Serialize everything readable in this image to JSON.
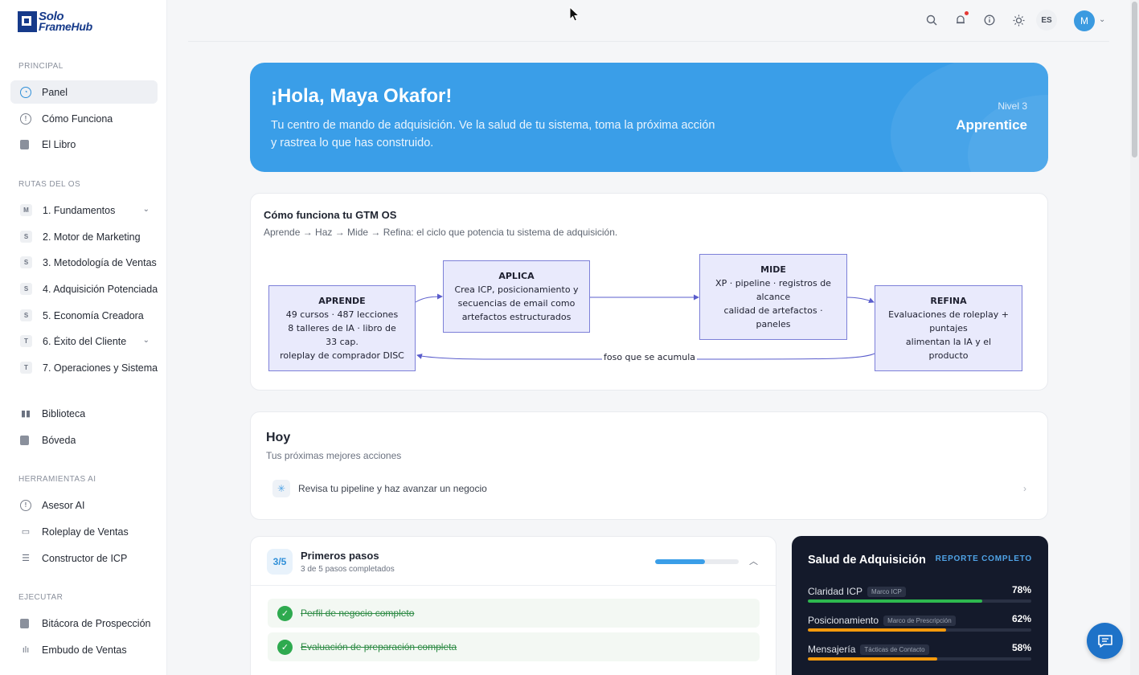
{
  "brand": {
    "line1": "Solo",
    "line2": "FrameHub"
  },
  "sidebar": {
    "principal_label": "PRINCIPAL",
    "principal": [
      {
        "label": "Panel",
        "icon": "dashboard-icon",
        "active": true
      },
      {
        "label": "Cómo Funciona",
        "icon": "info-icon"
      },
      {
        "label": "El Libro",
        "icon": "book-icon"
      }
    ],
    "routes_label": "RUTAS DEL OS",
    "routes": [
      {
        "badge": "M",
        "label": "1. Fundamentos"
      },
      {
        "badge": "S",
        "label": "2. Motor de Marketing"
      },
      {
        "badge": "S",
        "label": "3. Metodología de Ventas"
      },
      {
        "badge": "S",
        "label": "4. Adquisición Potenciada"
      },
      {
        "badge": "S",
        "label": "5. Economía Creadora"
      },
      {
        "badge": "T",
        "label": "6. Éxito del Cliente"
      },
      {
        "badge": "T",
        "label": "7. Operaciones y Sistemas"
      }
    ],
    "library": [
      {
        "label": "Biblioteca",
        "icon": "library-icon"
      },
      {
        "label": "Bóveda",
        "icon": "vault-icon"
      }
    ],
    "ai_label": "HERRAMIENTAS AI",
    "ai": [
      {
        "label": "Asesor AI",
        "icon": "advisor-icon"
      },
      {
        "label": "Roleplay de Ventas",
        "icon": "monitor-icon"
      },
      {
        "label": "Constructor de ICP",
        "icon": "document-icon"
      }
    ],
    "exec_label": "EJECUTAR",
    "exec": [
      {
        "label": "Bitácora de Prospección",
        "icon": "mail-icon"
      },
      {
        "label": "Embudo de Ventas",
        "icon": "bars-icon"
      }
    ]
  },
  "topbar": {
    "lang": "ES",
    "avatar": "M"
  },
  "hero": {
    "title": "¡Hola, Maya Okafor!",
    "subtitle": "Tu centro de mando de adquisición. Ve la salud de tu sistema, toma la próxima acción y rastrea lo que has construido.",
    "level_label": "Nivel 3",
    "level": "Apprentice"
  },
  "gtm": {
    "title": "Cómo funciona tu GTM OS",
    "subtitle": "Aprende → Haz → Mide → Refina: el ciclo que potencia tu sistema de adquisición.",
    "boxes": [
      {
        "title": "APRENDE",
        "lines": [
          "49 cursos · 487 lecciones",
          "8 talleres de IA · libro de",
          "33 cap.",
          "roleplay de comprador DISC"
        ]
      },
      {
        "title": "APLICA",
        "lines": [
          "Crea ICP, posicionamiento y",
          "secuencias de email como",
          "artefactos estructurados"
        ]
      },
      {
        "title": "MIDE",
        "lines": [
          "XP · pipeline · registros de",
          "alcance",
          "calidad de artefactos ·",
          "paneles"
        ]
      },
      {
        "title": "REFINA",
        "lines": [
          "Evaluaciones de roleplay +",
          "puntajes",
          "alimentan la IA y el",
          "producto"
        ]
      }
    ],
    "loop_label": "foso que se acumula"
  },
  "today": {
    "title": "Hoy",
    "subtitle": "Tus próximas mejores acciones",
    "action": "Revisa tu pipeline y haz avanzar un negocio"
  },
  "steps": {
    "count": "3/5",
    "title": "Primeros pasos",
    "subtitle": "3 de 5 pasos completados",
    "progress": 0.6,
    "items": [
      {
        "label": "Perfil de negocio completo",
        "done": true
      },
      {
        "label": "Evaluación de preparación completa",
        "done": true
      }
    ]
  },
  "health": {
    "title": "Salud de Adquisición",
    "link": "REPORTE COMPLETO",
    "metrics": [
      {
        "name": "Claridad ICP",
        "tag": "Marco ICP",
        "value": "78%",
        "pct": 78,
        "color": "#2eb84f"
      },
      {
        "name": "Posicionamiento",
        "tag": "Marco de Prescripción",
        "value": "62%",
        "pct": 62,
        "color": "#f59a0c"
      },
      {
        "name": "Mensajería",
        "tag": "Tácticas de Contacto",
        "value": "58%",
        "pct": 58,
        "color": "#f59a0c"
      }
    ]
  }
}
